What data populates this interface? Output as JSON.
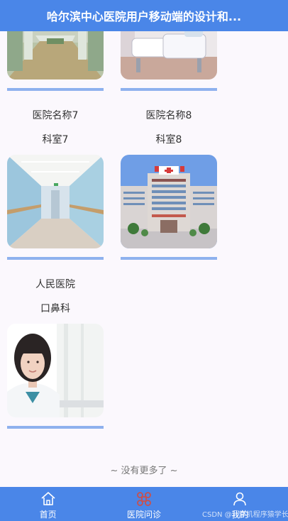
{
  "header": {
    "title": "哈尔滨中心医院用户移动端的设计和..."
  },
  "cards": [
    {
      "hospital": "医院名称7",
      "department": "科室7"
    },
    {
      "hospital": "医院名称8",
      "department": "科室8"
    },
    {
      "hospital": "人民医院",
      "department": "口鼻科"
    },
    {
      "hospital": "",
      "department": ""
    },
    {
      "hospital": "",
      "department": ""
    }
  ],
  "list_end": "~ 没有更多了 ~",
  "tabbar": {
    "items": [
      {
        "label": "首页",
        "icon": "home-icon"
      },
      {
        "label": "医院问诊",
        "icon": "consult-icon"
      },
      {
        "label": "我的",
        "icon": "user-icon"
      }
    ]
  },
  "watermark": "CSDN @计算机程序猿学长",
  "colors": {
    "primary": "#4a86e8",
    "bar": "#8eb1ee",
    "active_icon": "#c8504e"
  }
}
